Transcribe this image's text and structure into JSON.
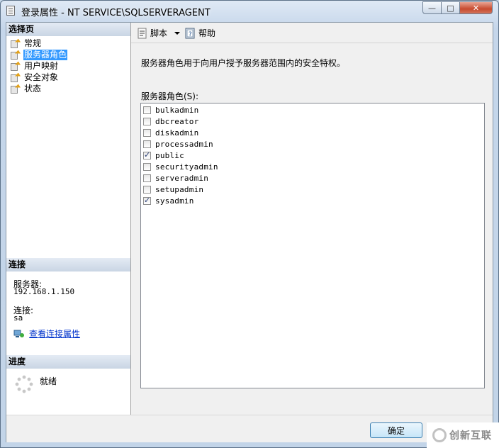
{
  "window": {
    "title": "登录属性 - NT SERVICE\\SQLSERVERAGENT",
    "min_glyph": "—",
    "max_glyph": "□",
    "close_glyph": "✕"
  },
  "left": {
    "select_page_header": "选择页",
    "pages": [
      {
        "label": "常规",
        "icon": "page-wrench-icon"
      },
      {
        "label": "服务器角色",
        "icon": "page-wrench-icon",
        "selected": true
      },
      {
        "label": "用户映射",
        "icon": "page-wrench-icon"
      },
      {
        "label": "安全对象",
        "icon": "page-wrench-icon"
      },
      {
        "label": "状态",
        "icon": "page-wrench-icon"
      }
    ],
    "connection_header": "连接",
    "server_label": "服务器:",
    "server_value": "192.168.1.150",
    "connection_label": "连接:",
    "connection_value": "sa",
    "view_props_link": "查看连接属性",
    "progress_header": "进度",
    "progress_status": "就绪"
  },
  "toolbar": {
    "script_label": "脚本",
    "help_label": "帮助"
  },
  "main": {
    "description": "服务器角色用于向用户授予服务器范围内的安全特权。",
    "roles_label": "服务器角色(S):",
    "roles": [
      {
        "name": "bulkadmin",
        "checked": false
      },
      {
        "name": "dbcreator",
        "checked": false
      },
      {
        "name": "diskadmin",
        "checked": false
      },
      {
        "name": "processadmin",
        "checked": false
      },
      {
        "name": "public",
        "checked": true
      },
      {
        "name": "securityadmin",
        "checked": false
      },
      {
        "name": "serveradmin",
        "checked": false
      },
      {
        "name": "setupadmin",
        "checked": false
      },
      {
        "name": "sysadmin",
        "checked": true
      }
    ]
  },
  "footer": {
    "ok_label": "确定"
  },
  "watermark": {
    "text": "创新互联"
  }
}
